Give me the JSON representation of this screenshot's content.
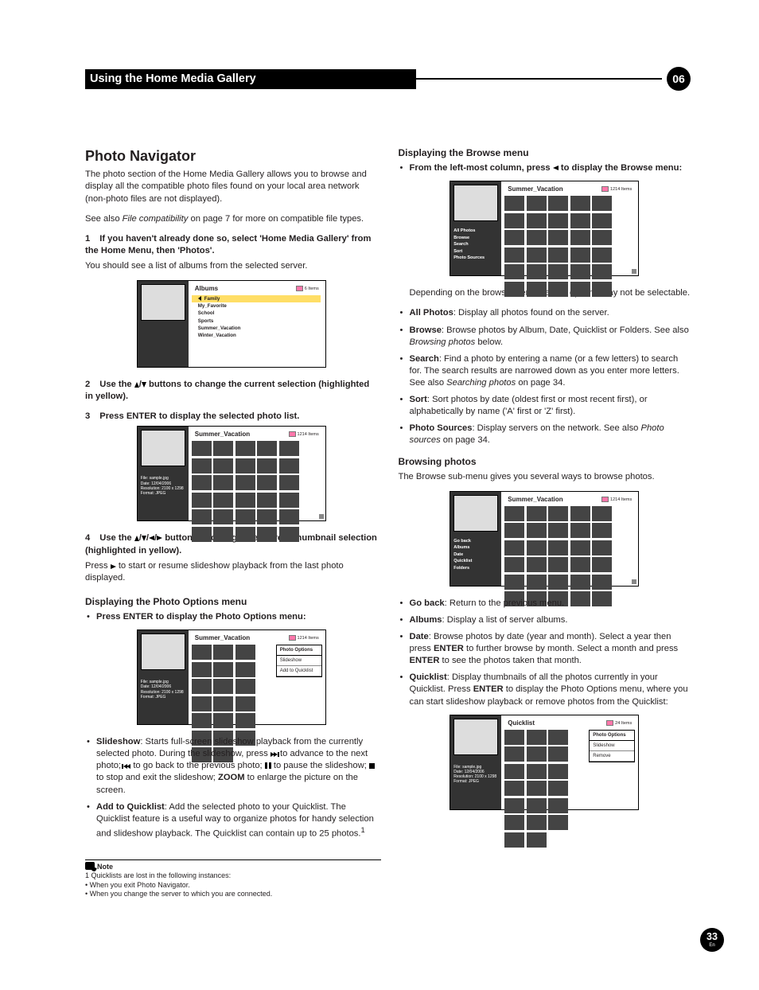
{
  "header": {
    "title": "Using the Home Media Gallery",
    "chapter": "06"
  },
  "left": {
    "h1": "Photo Navigator",
    "intro": "The photo section of the Home Media Gallery allows you to browse and display all the compatible photo files found on your local area network (non-photo files are not displayed).",
    "seealso_a": "See also ",
    "seealso_em": "File compatibility",
    "seealso_b": " on page 7 for more on compatible file types.",
    "step1_num": "1",
    "step1_lead": "If you haven't already done so, select 'Home Media Gallery' from the Home Menu, then 'Photos'.",
    "step1_sub": "You should see a list of albums from the selected server.",
    "shot1": {
      "title": "Albums",
      "count": "6 Items",
      "rows": [
        "Family",
        "My_Favorite",
        "School",
        "Sports",
        "Summer_Vacation",
        "Winter_Vacation"
      ]
    },
    "step2_num": "2",
    "step2_a": "Use the ",
    "step2_b": " buttons to change the current selection (highlighted in yellow).",
    "step3_num": "3",
    "step3_lead": "Press ENTER to display the selected photo list.",
    "shot2": {
      "title": "Summer_Vacation",
      "count": "1214 Items",
      "meta": "File: sample.jpg\nDate: 12/04/2006\nResolution: 2100 x 1298\nFormat: JPEG"
    },
    "step4_num": "4",
    "step4_a": "Use the ",
    "step4_b": " buttons to change the current thumbnail selection (highlighted in yellow).",
    "step4_sub_a": "Press ",
    "step4_sub_b": " to start or resume slideshow playback from the last photo displayed.",
    "h2_opt": "Displaying the Photo Options menu",
    "opt_bullet": "Press ENTER to display the Photo Options menu:",
    "shot3": {
      "title": "Summer_Vacation",
      "count": "1214 Items",
      "meta": "File: sample.jpg\nDate: 12/04/2006\nResolution: 2100 x 1298\nFormat: JPEG",
      "popup": {
        "header": "Photo Options",
        "items": [
          "Slideshow",
          "Add to Quicklist"
        ]
      }
    },
    "slide_b": "Slideshow",
    "slide_t1": ": Starts full-screen slideshow playback from the currently selected photo. During the slideshow, press ",
    "slide_t2": " to advance to the next photo; ",
    "slide_t3": " to go back to the previous photo; ",
    "slide_t4": " to pause the slideshow; ",
    "slide_t5": " to stop and exit the slideshow; ",
    "slide_zoom": "ZOOM",
    "slide_t6": " to enlarge the picture on the screen.",
    "addq_b": "Add to Quicklist",
    "addq_t": ": Add the selected photo to your Quicklist. The Quicklist feature is a useful way to organize photos for handy selection and slideshow playback. The Quicklist can contain up to 25 photos.",
    "addq_fn": "1"
  },
  "right": {
    "h2_browse": "Displaying the Browse menu",
    "browse_lead_a": "From the left-most column, press ",
    "browse_lead_b": " to display the Browse menu:",
    "shot4": {
      "title": "Summer_Vacation",
      "count": "1214 Items",
      "menu": [
        "All Photos",
        "Browse",
        "Search",
        "Sort",
        "Photo Sources"
      ]
    },
    "browse_note": "Depending on the browse menu, certain options may not be selectable.",
    "opts": [
      {
        "b": "All Photos",
        "t": ": Display all photos found on the server."
      },
      {
        "b": "Browse",
        "t": ": Browse photos by Album, Date, Quicklist or Folders. See also ",
        "em": "Browsing photos",
        "t2": " below."
      },
      {
        "b": "Search",
        "t": ": Find a photo by entering a name (or a few letters) to search for. The search results are narrowed down as you enter more letters. See also ",
        "em": "Searching photos",
        "t2": " on page 34."
      },
      {
        "b": "Sort",
        "t": ": Sort photos by date (oldest first or most recent first), or alphabetically by name ('A' first or 'Z' first)."
      },
      {
        "b": "Photo Sources",
        "t": ": Display servers on the network. See also ",
        "em": "Photo sources",
        "t2": " on page 34."
      }
    ],
    "h2_bp": "Browsing photos",
    "bp_intro": "The Browse sub-menu gives you several ways to browse photos.",
    "shot5": {
      "title": "Summer_Vacation",
      "count": "1214 Items",
      "menu": [
        "Go back",
        "Albums",
        "Date",
        "Quicklist",
        "Folders"
      ]
    },
    "bp": [
      {
        "b": "Go back",
        "t": ": Return to the previous menu."
      },
      {
        "b": "Albums",
        "t": ": Display a list of server albums."
      },
      {
        "b": "Date",
        "t": ": Browse photos by date (year and month). Select a year then press ",
        "k1": "ENTER",
        "t2": " to further browse by month. Select a month and press ",
        "k2": "ENTER",
        "t3": " to see the photos taken that month."
      },
      {
        "b": "Quicklist",
        "t": ": Display thumbnails of all the photos currently in your Quicklist. Press ",
        "k1": "ENTER",
        "t2": " to display the Photo Options menu, where you can start slideshow playback or remove photos from the Quicklist:"
      }
    ],
    "shot6": {
      "title": "Quicklist",
      "count": "24 Items",
      "meta": "File: sample.jpg\nDate: 12/04/2006\nResolution: 2100 x 1298\nFormat: JPEG",
      "popup": {
        "header": "Photo Options",
        "items": [
          "Slideshow",
          "Remove"
        ]
      }
    }
  },
  "footnote": {
    "hdr": "Note",
    "l1": "1 Quicklists are lost in the following instances:",
    "l2": "• When you exit Photo Navigator.",
    "l3": "• When you change the server to which you are connected."
  },
  "page": {
    "num": "33",
    "lang": "En"
  }
}
